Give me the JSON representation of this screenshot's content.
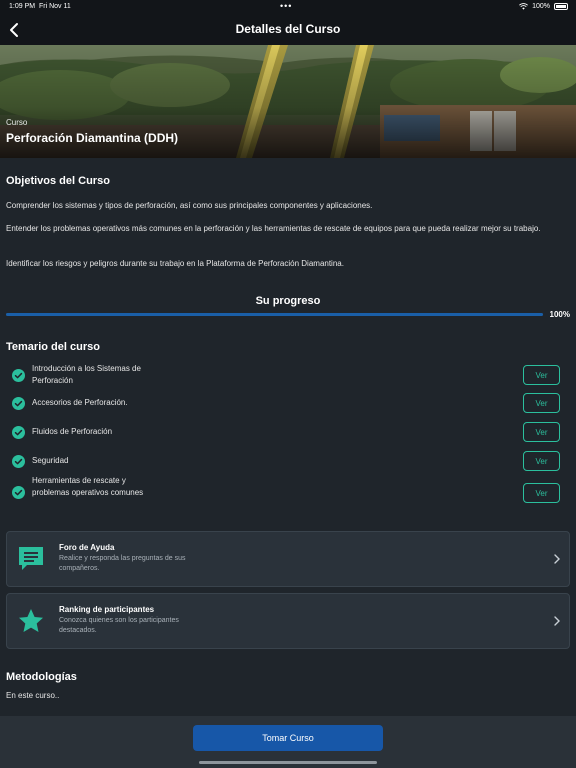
{
  "status_bar": {
    "time": "1:09 PM",
    "date": "Fri Nov 11",
    "dots": "•••",
    "battery": "100%",
    "icons": [
      "wifi-icon",
      "battery-icon"
    ]
  },
  "nav": {
    "title": "Detalles del Curso",
    "back_icon": "chevron-left-icon"
  },
  "hero": {
    "kicker": "Curso",
    "title": "Perforación Diamantina (DDH)"
  },
  "objectives": {
    "title": "Objetivos del Curso",
    "paragraphs": [
      "Comprender los sistemas y tipos de perforación, así como sus principales componentes y aplicaciones.",
      "Entender los problemas operativos más comunes en la perforación y las herramientas de rescate de equipos para que pueda realizar mejor su trabajo.",
      "Identificar los riesgos y peligros durante su trabajo en la Plataforma de Perforación Diamantina."
    ]
  },
  "progress": {
    "label": "Su progreso",
    "value_text": "100%",
    "fraction": 1.0,
    "color": "#1a5fa8"
  },
  "syllabus": {
    "title": "Temario del curso",
    "action_label": "Ver",
    "items": [
      {
        "label": "Introducción a los Sistemas de Perforación",
        "completed": true
      },
      {
        "label": "Accesorios de Perforación.",
        "completed": true
      },
      {
        "label": "Fluidos de Perforación",
        "completed": true
      },
      {
        "label": "Seguridad",
        "completed": true
      },
      {
        "label": "Herramientas de rescate y problemas operativos comunes",
        "completed": true
      }
    ]
  },
  "cards": {
    "forum": {
      "title": "Foro de Ayuda",
      "subtitle": "Realice y responda las preguntas de sus compañeros.",
      "icon": "chat-bubble-icon"
    },
    "ranking": {
      "title": "Ranking de participantes",
      "subtitle": "Conozca quienes son los participantes destacados.",
      "icon": "star-icon"
    }
  },
  "methodology": {
    "title": "Metodologías",
    "text": "En este curso.."
  },
  "cta": {
    "label": "Tomar Curso"
  },
  "colors": {
    "background": "#1f252b",
    "accent": "#2bbf9d",
    "primary": "#1757a8"
  }
}
